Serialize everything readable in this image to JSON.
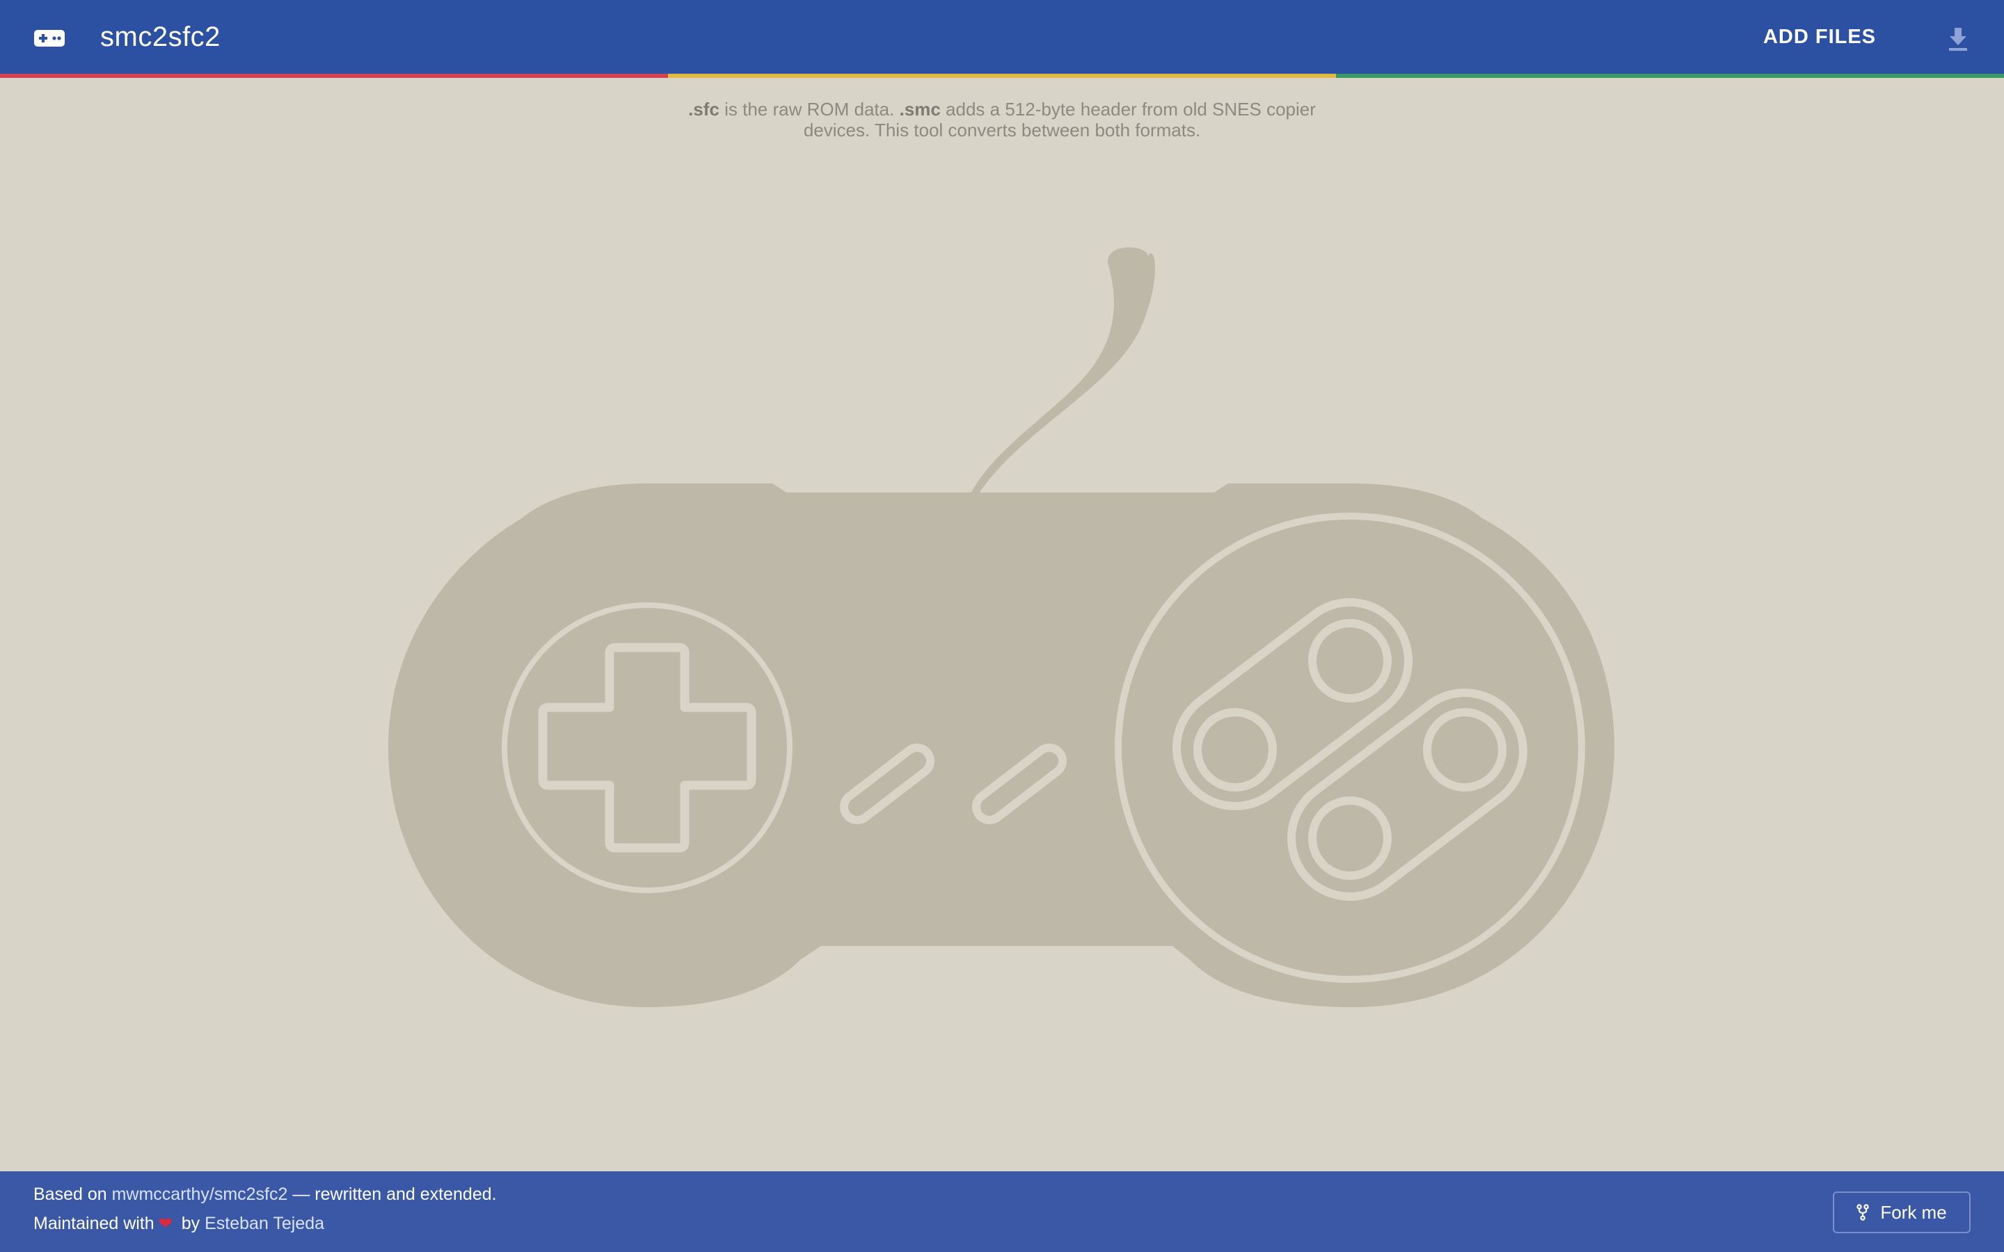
{
  "header": {
    "app_title": "smc2sfc2",
    "logo_icon": "gamepad-icon",
    "add_files_label": "ADD FILES",
    "download_icon": "download-icon",
    "stripe_colors": [
      "#d34155",
      "#e2b942",
      "#3a9a64"
    ],
    "background_color": "#2c51a3"
  },
  "intro": {
    "sfc_ext": ".sfc",
    "text_1": " is the raw ROM data. ",
    "smc_ext": ".smc",
    "text_2": " adds a 512-byte header from old SNES copier devices. This tool converts between both formats."
  },
  "illustration": {
    "icon": "snes-controller-icon",
    "fill_color": "#bdb8a8",
    "line_color": "#d8d5c8"
  },
  "footer": {
    "based_on_prefix": "Based on ",
    "based_on_link": "mwmccarthy/smc2sfc2",
    "based_on_suffix": " — rewritten and extended.",
    "maintained_prefix": "Maintained with",
    "heart_icon": "heart-icon",
    "maintained_by": " by ",
    "author_link": "Esteban Tejeda",
    "fork_label": "Fork me",
    "fork_icon": "git-fork-icon",
    "background_color": "#3a58a6"
  }
}
